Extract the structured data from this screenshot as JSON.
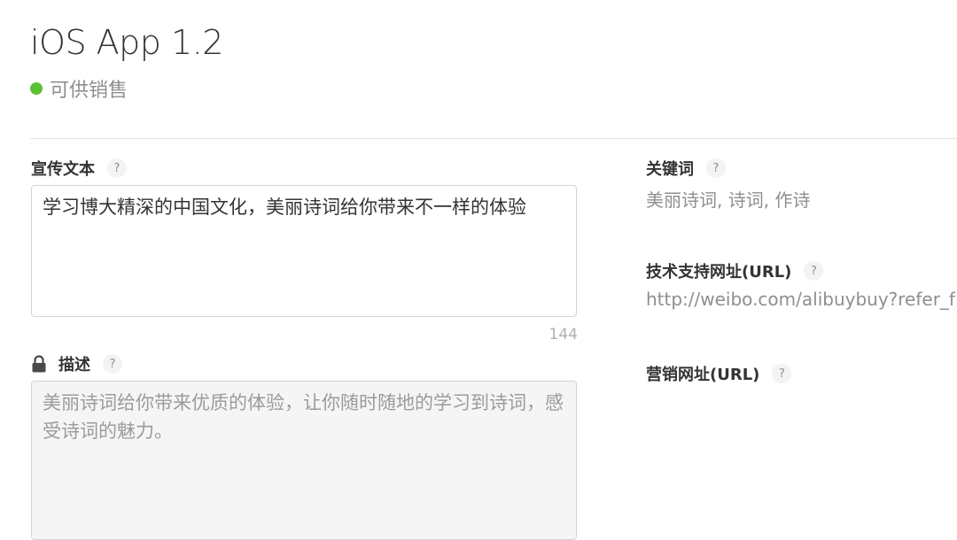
{
  "app": {
    "title": "iOS App 1.2",
    "status": "可供销售",
    "status_color": "#5bc236"
  },
  "promo_text": {
    "label": "宣传文本",
    "help": "?",
    "value": "学习博大精深的中国文化，美丽诗词给你带来不一样的体验",
    "counter": "144"
  },
  "description": {
    "label": "描述",
    "help": "?",
    "value": "美丽诗词给你带来优质的体验，让你随时随地的学习到诗词，感受诗词的魅力。",
    "icon": "lock-icon"
  },
  "keywords": {
    "label": "关键词",
    "help": "?",
    "value": "美丽诗词, 诗词, 作诗"
  },
  "support_url": {
    "label": "技术支持网址(URL)",
    "help": "?",
    "value": "http://weibo.com/alibuybuy?refer_f"
  },
  "marketing_url": {
    "label": "营销网址(URL)",
    "help": "?"
  }
}
